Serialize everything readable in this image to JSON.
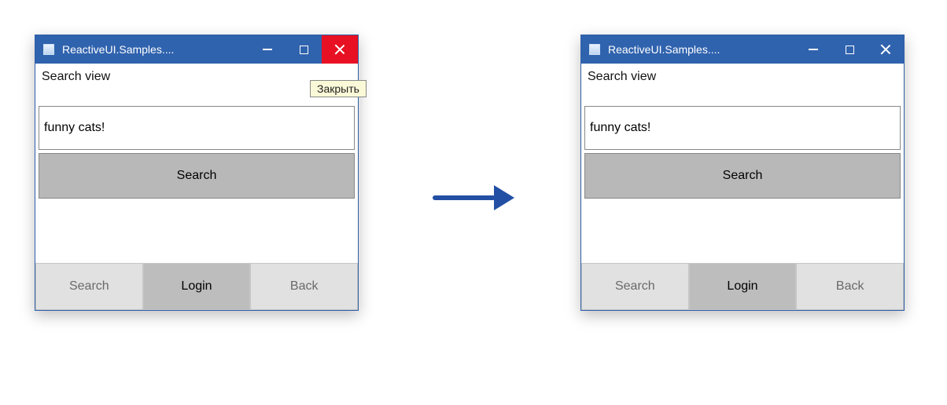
{
  "arrow": {
    "direction": "right"
  },
  "tooltip_text": "Закрыть",
  "window_left": {
    "title": "ReactiveUI.Samples....",
    "close_hover": true,
    "view_label": "Search view",
    "search_input_value": "funny cats!",
    "search_button_label": "Search",
    "bottom": {
      "search": "Search",
      "login": "Login",
      "back": "Back"
    }
  },
  "window_right": {
    "title": "ReactiveUI.Samples....",
    "close_hover": false,
    "view_label": "Search view",
    "search_input_value": "funny cats!",
    "search_button_label": "Search",
    "bottom": {
      "search": "Search",
      "login": "Login",
      "back": "Back"
    }
  }
}
